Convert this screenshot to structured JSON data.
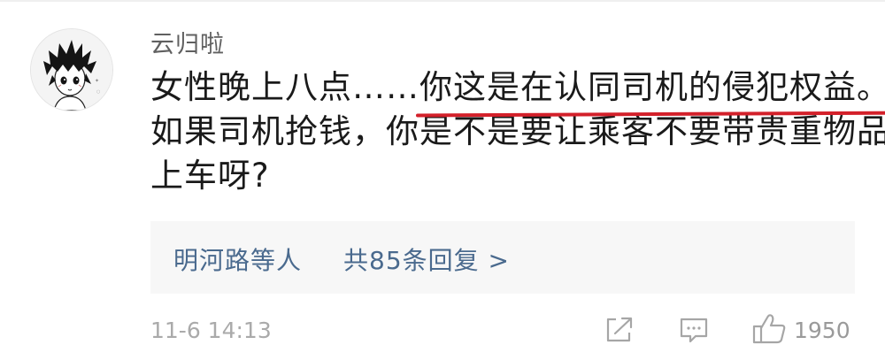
{
  "comment": {
    "username": "云归啦",
    "text_line1_plain": "女性晚上八点……",
    "text_line1_underlined": "你这是在认同司机的侵犯权益。",
    "text_line2": "如果司机抢钱，你是不是要让乘客不要带贵重物品",
    "text_line3": "上车呀?",
    "underline_color": "#d3202a"
  },
  "replies": {
    "names": "明河路等人",
    "count_label": "共85条回复 >",
    "link_color": "#4a6a8e"
  },
  "footer": {
    "timestamp": "11-6 14:13",
    "share_icon": "share-icon",
    "comment_icon": "comment-icon",
    "like_icon": "thumbs-up-icon",
    "like_count": "1950"
  }
}
